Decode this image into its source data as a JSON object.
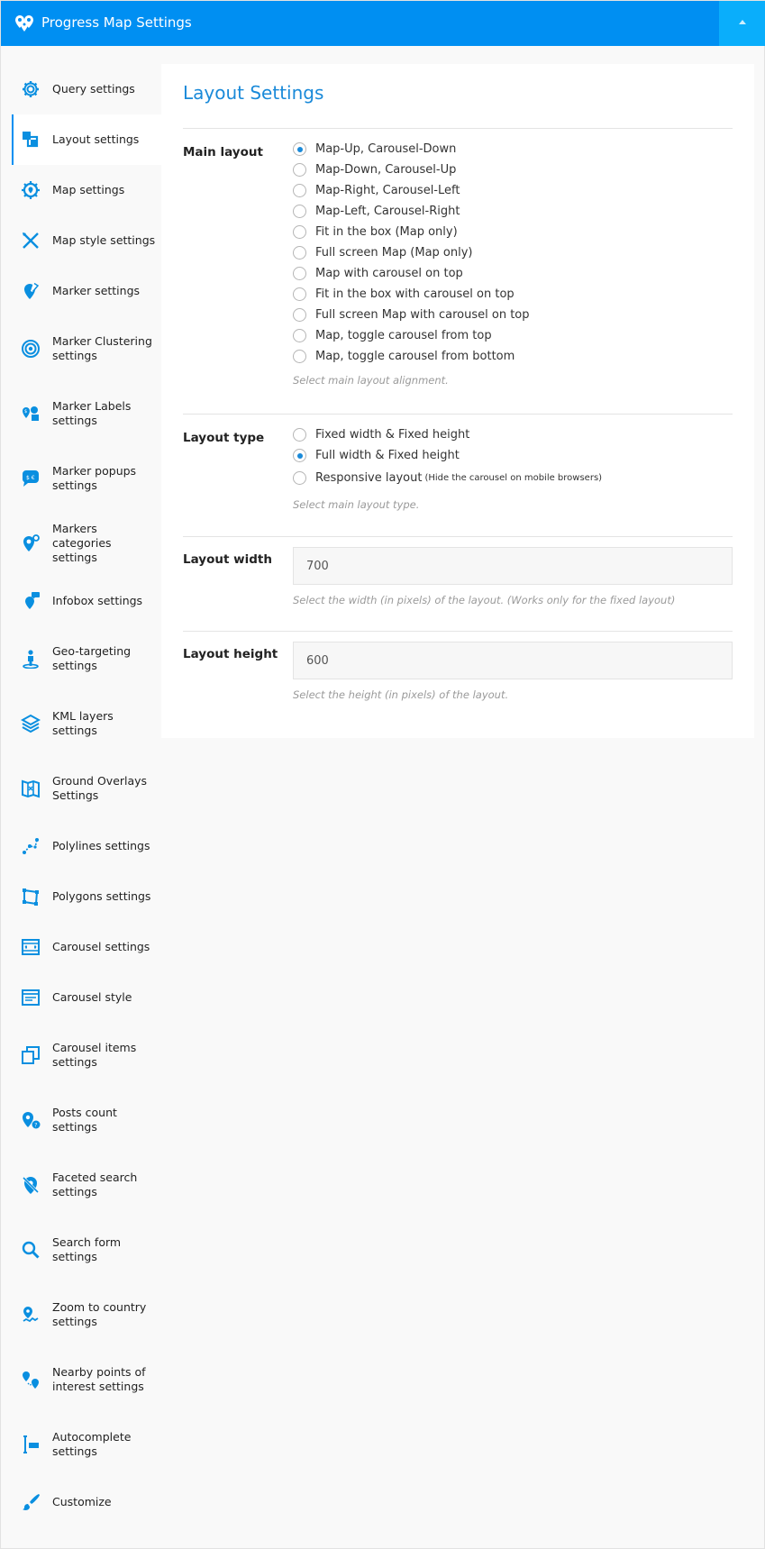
{
  "header": {
    "title": "Progress Map Settings",
    "color": "#008ff2",
    "toggle_color": "#0aaefb"
  },
  "sidebar": {
    "items": [
      {
        "label": "Query settings",
        "icon": "gear-icon"
      },
      {
        "label": "Layout settings",
        "icon": "layout-icon",
        "active": true
      },
      {
        "label": "Map settings",
        "icon": "map-gear-icon"
      },
      {
        "label": "Map style settings",
        "icon": "pencil-ruler-icon"
      },
      {
        "label": "Marker settings",
        "icon": "marker-pen-icon"
      },
      {
        "label": "Marker Clustering\nsettings",
        "icon": "cluster-target-icon"
      },
      {
        "label": "Marker Labels\nsettings",
        "icon": "marker-labels-icon"
      },
      {
        "label": "Marker popups\nsettings",
        "icon": "popup-bubble-icon"
      },
      {
        "label": "Markers\ncategories settings",
        "icon": "marker-categories-icon"
      },
      {
        "label": "Infobox settings",
        "icon": "infobox-icon"
      },
      {
        "label": "Geo-targeting\nsettings",
        "icon": "person-pin-icon"
      },
      {
        "label": "KML layers\nsettings",
        "icon": "layers-icon"
      },
      {
        "label": "Ground Overlays\nSettings",
        "icon": "map-overlay-icon"
      },
      {
        "label": "Polylines settings",
        "icon": "polyline-icon"
      },
      {
        "label": "Polygons settings",
        "icon": "polygon-icon"
      },
      {
        "label": "Carousel settings",
        "icon": "carousel-icon"
      },
      {
        "label": "Carousel style",
        "icon": "carousel-style-icon"
      },
      {
        "label": "Carousel items\nsettings",
        "icon": "carousel-items-icon"
      },
      {
        "label": "Posts count\nsettings",
        "icon": "posts-count-icon"
      },
      {
        "label": "Faceted search\nsettings",
        "icon": "faceted-search-icon"
      },
      {
        "label": "Search form\nsettings",
        "icon": "search-icon"
      },
      {
        "label": "Zoom to country\nsettings",
        "icon": "zoom-country-icon"
      },
      {
        "label": "Nearby points of\ninterest settings",
        "icon": "nearby-poi-icon"
      },
      {
        "label": "Autocomplete\nsettings",
        "icon": "autocomplete-icon"
      },
      {
        "label": "Customize",
        "icon": "paintbrush-icon"
      }
    ]
  },
  "main": {
    "title": "Layout Settings",
    "main_layout": {
      "label": "Main layout",
      "options": [
        {
          "label": "Map-Up, Carousel-Down",
          "checked": true
        },
        {
          "label": "Map-Down, Carousel-Up",
          "checked": false
        },
        {
          "label": "Map-Right, Carousel-Left",
          "checked": false
        },
        {
          "label": "Map-Left, Carousel-Right",
          "checked": false
        },
        {
          "label": "Fit in the box (Map only)",
          "checked": false
        },
        {
          "label": "Full screen Map (Map only)",
          "checked": false
        },
        {
          "label": "Map with carousel on top",
          "checked": false
        },
        {
          "label": "Fit in the box with carousel on top",
          "checked": false
        },
        {
          "label": "Full screen Map with carousel on top",
          "checked": false
        },
        {
          "label": "Map, toggle carousel from top",
          "checked": false
        },
        {
          "label": "Map, toggle carousel from bottom",
          "checked": false
        }
      ],
      "hint": "Select main layout alignment."
    },
    "layout_type": {
      "label": "Layout type",
      "options": [
        {
          "label": "Fixed width & Fixed height",
          "checked": false,
          "note": ""
        },
        {
          "label": "Full width & Fixed height",
          "checked": true,
          "note": ""
        },
        {
          "label": "Responsive layout",
          "checked": false,
          "note": "(Hide the carousel on mobile browsers)"
        }
      ],
      "hint": "Select main layout type."
    },
    "layout_width": {
      "label": "Layout width",
      "value": "700",
      "hint": "Select the width (in pixels) of the layout. (Works only for the fixed layout)"
    },
    "layout_height": {
      "label": "Layout height",
      "value": "600",
      "hint": "Select the height (in pixels) of the layout."
    }
  }
}
